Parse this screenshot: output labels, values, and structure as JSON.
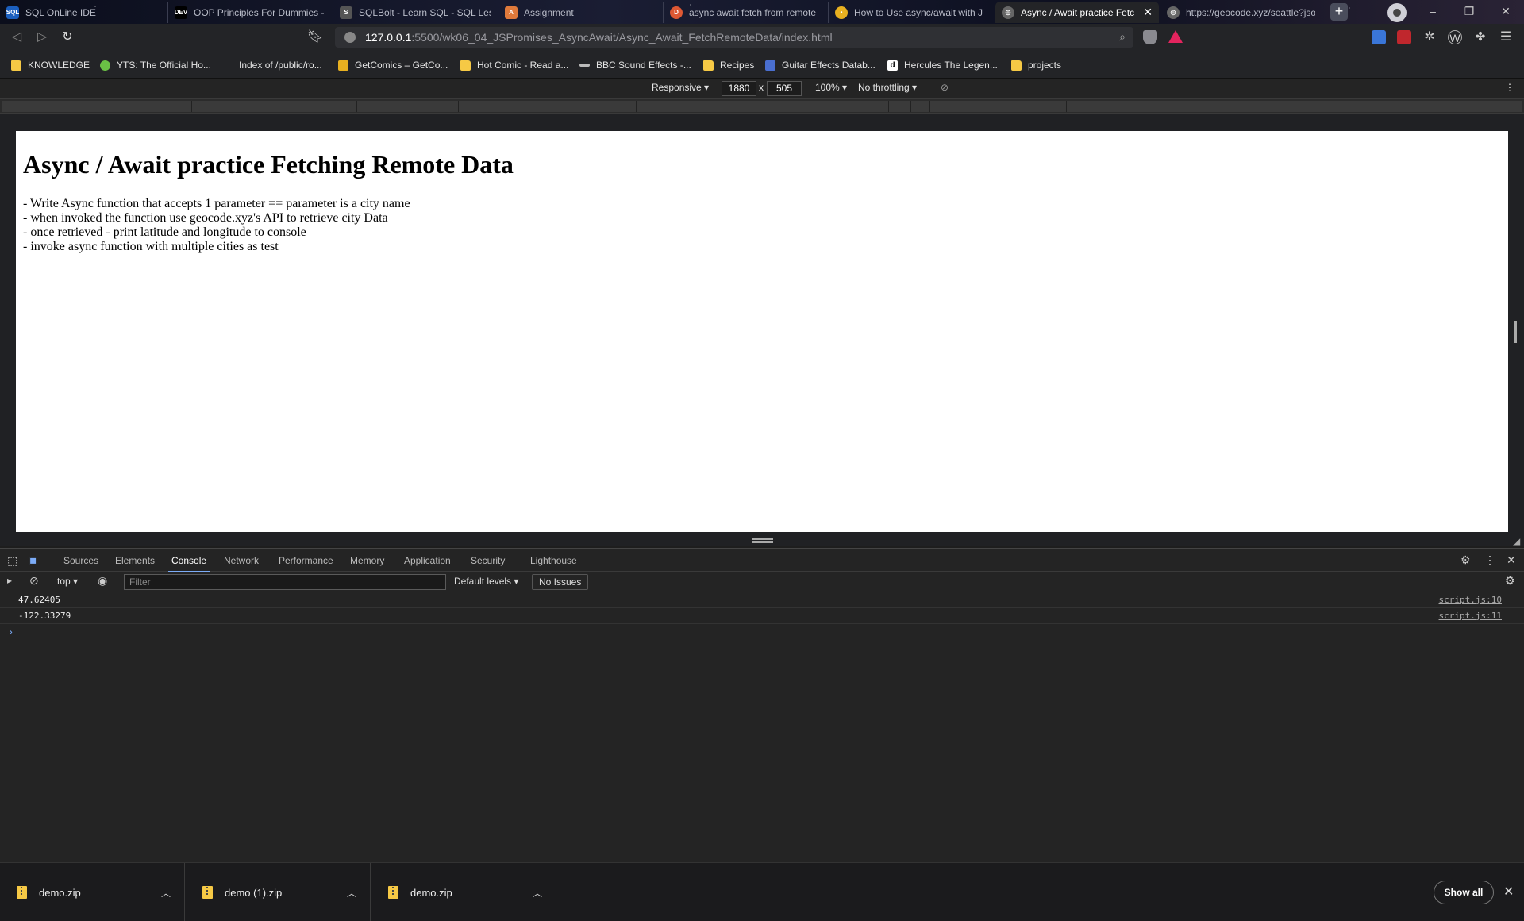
{
  "browser": {
    "tabs": [
      {
        "title": "SQL OnLine IDE",
        "favicon": "sql-favicon",
        "color": "#1b5fbf",
        "glyph": "SQL"
      },
      {
        "title": "OOP Principles For Dummies -",
        "favicon": "dev-favicon",
        "color": "#000000",
        "glyph": "DEV"
      },
      {
        "title": "SQLBolt - Learn SQL - SQL Less",
        "favicon": "sqlbolt-favicon",
        "color": "#555555",
        "glyph": "S"
      },
      {
        "title": "Assignment",
        "favicon": "assignment-favicon",
        "color": "#e07a3b",
        "glyph": "A"
      },
      {
        "title": "async await fetch from remote",
        "favicon": "duckduckgo-favicon",
        "color": "#de5833",
        "glyph": "D"
      },
      {
        "title": "How to Use async/await with J",
        "favicon": "bulb-favicon",
        "color": "#e8b020",
        "glyph": "•"
      },
      {
        "title": "Async / Await practice Fetc",
        "favicon": "globe-favicon",
        "color": "#666666",
        "glyph": "◎",
        "active": true
      },
      {
        "title": "https://geocode.xyz/seattle?jso",
        "favicon": "globe-favicon",
        "color": "#666666",
        "glyph": "◎"
      }
    ],
    "new_tab_label": "+",
    "window_controls": [
      "–",
      "❐",
      "✕"
    ],
    "url": {
      "host": "127.0.0.1",
      "rest": ":5500/wk06_04_JSPromises_AsyncAwait/Async_Await_FetchRemoteData/index.html"
    },
    "bookmarks": [
      {
        "label": "KNOWLEDGE",
        "icon": "folder-icon",
        "color": "#f6c945"
      },
      {
        "label": "YTS: The Official Ho...",
        "icon": "yts-icon",
        "color": "#6ac045"
      },
      {
        "label": "Index of /public/ro...",
        "icon": "blank-icon",
        "color": ""
      },
      {
        "label": "GetComics – GetCo...",
        "icon": "getcomics-icon",
        "color": "#e8b020"
      },
      {
        "label": "Hot Comic - Read a...",
        "icon": "folder-icon",
        "color": "#f6c945"
      },
      {
        "label": "BBC Sound Effects -...",
        "icon": "bbc-icon",
        "color": "#bbbbbb"
      },
      {
        "label": "Recipes",
        "icon": "folder-icon",
        "color": "#f6c945"
      },
      {
        "label": "Guitar Effects Datab...",
        "icon": "guitar-icon",
        "color": "#4a6fd0"
      },
      {
        "label": "Hercules The Legen...",
        "icon": "d-icon",
        "color": "#ffffff"
      },
      {
        "label": "projects",
        "icon": "folder-icon",
        "color": "#f6c945"
      }
    ]
  },
  "device_toolbar": {
    "mode": "Responsive",
    "width": "1880",
    "times": "x",
    "height": "505",
    "zoom": "100%",
    "throttling": "No throttling"
  },
  "page": {
    "heading": "Async / Await practice Fetching Remote Data",
    "lines": [
      "- Write Async function that accepts 1 parameter == parameter is a city name",
      "- when invoked the function use geocode.xyz's API to retrieve city Data",
      "- once retrieved - print latitude and longitude to console",
      "- invoke async function with multiple cities as test"
    ]
  },
  "devtools": {
    "tabs": [
      "Sources",
      "Elements",
      "Console",
      "Network",
      "Performance",
      "Memory",
      "Application",
      "Security",
      "Lighthouse"
    ],
    "active_tab": "Console",
    "context": "top",
    "filter_placeholder": "Filter",
    "levels": "Default levels",
    "issues": "No Issues",
    "logs": [
      {
        "value": "47.62405",
        "source": "script.js:10"
      },
      {
        "value": "-122.33279",
        "source": "script.js:11"
      }
    ],
    "prompt": "›"
  },
  "downloads": {
    "items": [
      "demo.zip",
      "demo (1).zip",
      "demo.zip"
    ],
    "show_all": "Show all"
  }
}
